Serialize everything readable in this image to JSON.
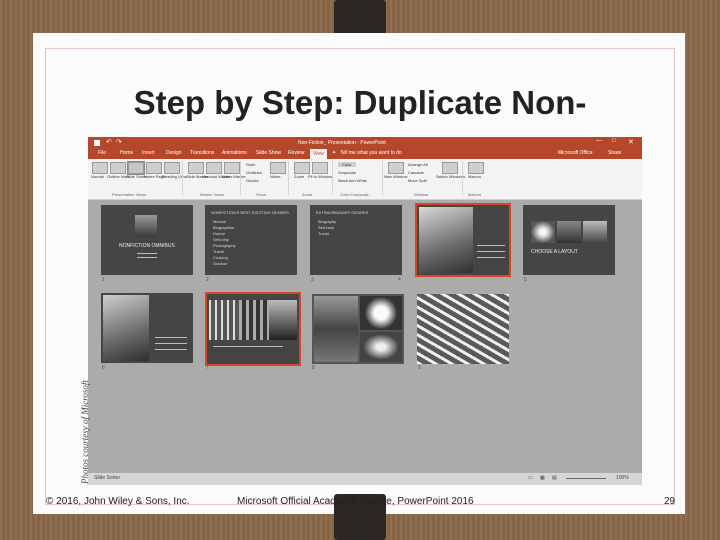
{
  "slide": {
    "title": "Step by Step: Duplicate Non-",
    "credit": "Photos courtesy of Microsoft",
    "footer_left": "© 2016, John Wiley & Sons, Inc.",
    "footer_center": "Microsoft Official Academic Course, PowerPoint 2016",
    "page_number": "29"
  },
  "app": {
    "window_title": "Non-Fiction_ Presentation - PowerPoint",
    "tabs": [
      "File",
      "Home",
      "Insert",
      "Design",
      "Transitions",
      "Animations",
      "Slide Show",
      "Review",
      "View"
    ],
    "active_tab": "View",
    "tell_me": "Tell me what you want to do",
    "user": "Microsoft Office",
    "share": "Share",
    "ribbon": {
      "buttons": [
        {
          "label": "Normal"
        },
        {
          "label": "Outline View"
        },
        {
          "label": "Slide Sorter"
        },
        {
          "label": "Notes Page"
        },
        {
          "label": "Reading View"
        },
        {
          "label": "Slide Master"
        },
        {
          "label": "Handout Master"
        },
        {
          "label": "Notes Master"
        },
        {
          "label": "Ruler"
        },
        {
          "label": "Gridlines"
        },
        {
          "label": "Guides"
        },
        {
          "label": "Notes"
        },
        {
          "label": "Zoom"
        },
        {
          "label": "Fit to Window"
        },
        {
          "label": "Color"
        },
        {
          "label": "Grayscale"
        },
        {
          "label": "Black and White"
        },
        {
          "label": "New Window"
        },
        {
          "label": "Arrange All"
        },
        {
          "label": "Cascade"
        },
        {
          "label": "Move Split"
        },
        {
          "label": "Switch Windows"
        },
        {
          "label": "Macros"
        }
      ],
      "groups": [
        "Presentation Views",
        "Master Views",
        "Show",
        "Zoom",
        "Color/Grayscale",
        "Window",
        "Macros"
      ]
    },
    "slides": [
      {
        "num": "1",
        "title": "NONFICTION OMNIBUS"
      },
      {
        "num": "2",
        "title": "NONFICTION'S BEST EXCITING GENRES",
        "bullets": [
          "Memoir",
          "Biographies",
          "Humor",
          "Self-help",
          "Photography",
          "Travel",
          "Cooking",
          "Outdoor"
        ]
      },
      {
        "num": "3",
        "title": "EXTRAORDINARY GENRES",
        "bullets": [
          "Biography",
          "Self-help",
          "Travel"
        ]
      },
      {
        "num": "4",
        "title": ""
      },
      {
        "num": "5",
        "title": "CHOOSE A LAYOUT"
      },
      {
        "num": "6",
        "title": ""
      },
      {
        "num": "7",
        "title": ""
      },
      {
        "num": "8",
        "title": ""
      },
      {
        "num": "9",
        "title": ""
      }
    ],
    "status": {
      "left": "Slide Sorter",
      "zoom": "100%"
    }
  }
}
